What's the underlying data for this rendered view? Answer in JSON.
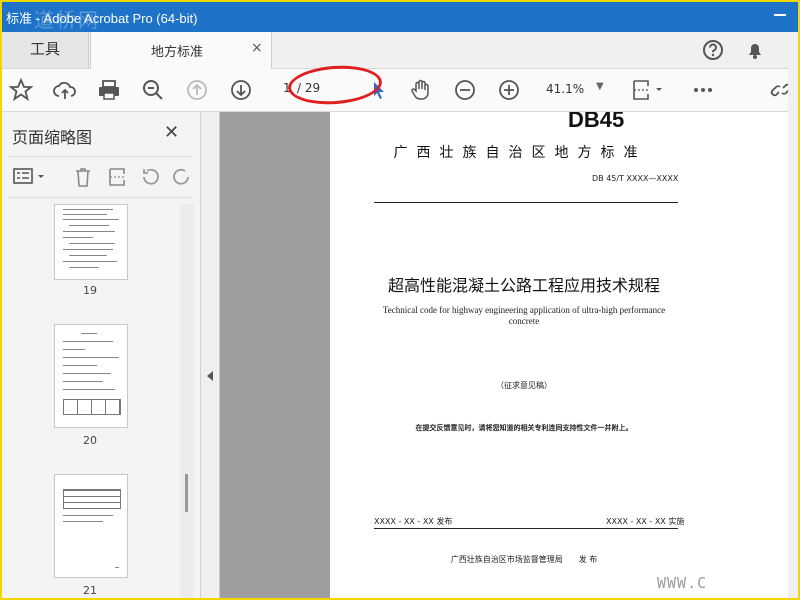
{
  "window": {
    "title": "标准 - Adobe Acrobat Pro (64-bit)",
    "watermark_top": "道桥网",
    "watermark_bottom": "WWW.C"
  },
  "tabs": {
    "tools": "工具",
    "document": "地方标准",
    "close": "×"
  },
  "toolbar": {
    "current_page": "1",
    "total_pages": "/ 29",
    "zoom": "41.1%",
    "zoom_caret": "▼"
  },
  "panel": {
    "title": "页面缩略图",
    "close": "✕"
  },
  "thumbnails": [
    {
      "label": "19"
    },
    {
      "label": "20"
    },
    {
      "label": "21"
    }
  ],
  "page": {
    "code": "DB45",
    "standard_type": "广西壮族自治区地方标准",
    "number": "DB 45/T XXXX—XXXX",
    "title_cn": "超高性能混凝土公路工程应用技术规程",
    "title_en": "Technical code for highway engineering application of ultra-high performance concrete",
    "draft": "（征求意见稿）",
    "note": "在提交反馈意见时，请将您知道的相关专利连同支持性文件一并附上。",
    "release_date": "XXXX - XX - XX 发布",
    "effective_date": "XXXX - XX - XX 实施",
    "publisher": "广西壮族自治区市场监督管理局　　发 布"
  }
}
